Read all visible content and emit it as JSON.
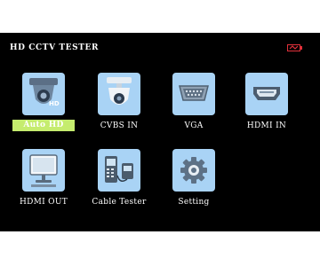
{
  "header": {
    "title": "HD CCTV TESTER"
  },
  "status": {
    "battery_icon": "battery-low-icon",
    "battery_color": "#e0303a"
  },
  "menu": {
    "selected_color": "#c5ec6e",
    "icon_background": "#a9d3f5",
    "items": [
      {
        "label": "Auto HD",
        "icon": "dome-camera-hd-icon",
        "selected": true
      },
      {
        "label": "CVBS IN",
        "icon": "dome-camera-icon",
        "selected": false
      },
      {
        "label": "VGA",
        "icon": "vga-port-icon",
        "selected": false
      },
      {
        "label": "HDMI IN",
        "icon": "hdmi-port-icon",
        "selected": false
      },
      {
        "label": "HDMI OUT",
        "icon": "monitor-icon",
        "selected": false
      },
      {
        "label": "Cable Tester",
        "icon": "cable-tester-icon",
        "selected": false
      },
      {
        "label": "Setting",
        "icon": "gear-icon",
        "selected": false
      }
    ]
  }
}
